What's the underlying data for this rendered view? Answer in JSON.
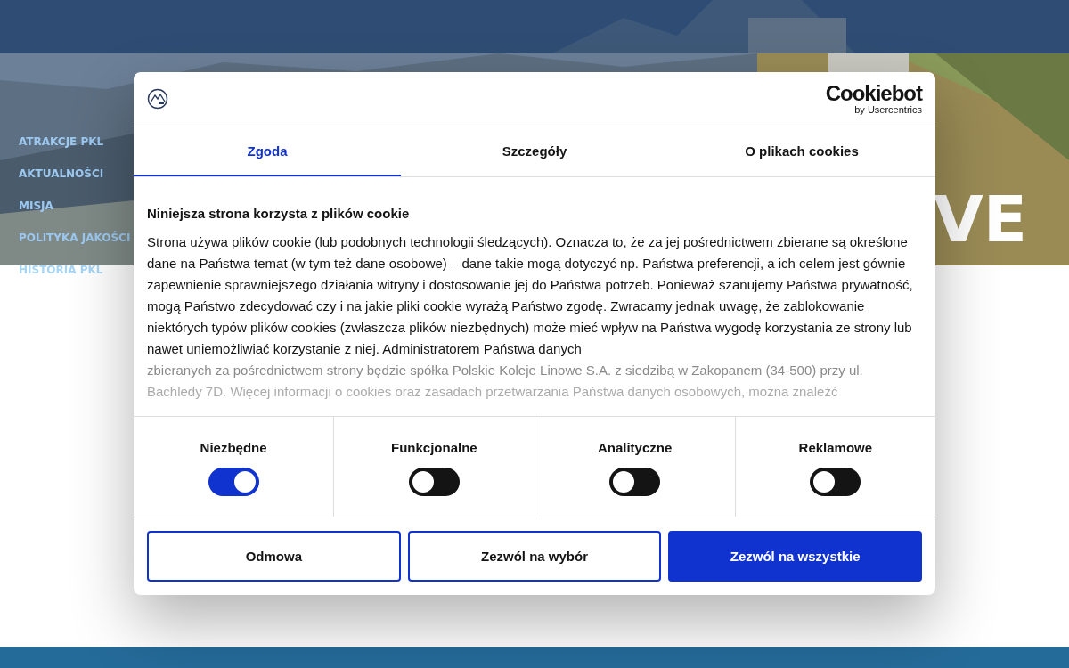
{
  "hero": {
    "heading": "VE"
  },
  "sidebar": {
    "items": [
      {
        "labels": [
          "ATRAKCJE PKL"
        ]
      },
      {
        "labels": [
          "AKTUALNOŚCI"
        ]
      },
      {
        "labels": [
          "MISJA"
        ]
      },
      {
        "labels": [
          "POLITYKA JAKOŚCI"
        ]
      },
      {
        "labels": [
          "HISTORIA PKL"
        ]
      }
    ]
  },
  "dialog": {
    "brand": {
      "name": "Cookiebot",
      "byline": "by Usercentrics"
    },
    "tabs": [
      {
        "label": "Zgoda",
        "selected": true
      },
      {
        "label": "Szczegóły",
        "selected": false
      },
      {
        "label": "O plikach cookies",
        "selected": false
      }
    ],
    "heading": "Niniejsza strona korzysta z plików cookie",
    "body": "Strona używa plików cookie (lub podobnych technologii śledzących). Oznacza to, że za jej pośrednictwem zbierane są określone dane na Państwa temat (w tym też dane osobowe) – dane takie mogą dotyczyć np. Państwa preferencji, a ich celem jest gównie zapewnienie sprawniejszego działania witryny i dostosowanie jej do Państwa potrzeb. Ponieważ szanujemy Państwa prywatność, mogą Państwo zdecydować czy i na jakie pliki cookie wyrażą Państwo zgodę. Zwracamy jednak uwagę, że zablokowanie niektórych typów plików cookies (zwłaszcza plików niezbędnych) może mieć wpływ na Państwa wygodę korzystania ze strony lub nawet uniemożliwiać korzystanie z niej. Administratorem Państwa danych",
    "body_faded": [
      "zbieranych za pośrednictwem strony będzie spółka Polskie Koleje Linowe S.A. z siedzibą w Zakopanem (34-500) przy ul.",
      "Bachledy 7D. Więcej informacji o cookies oraz zasadach przetwarzania Państwa danych osobowych, można znaleźć"
    ],
    "categories": [
      {
        "label": "Niezbędne",
        "on": true
      },
      {
        "label": "Funkcjonalne",
        "on": false
      },
      {
        "label": "Analityczne",
        "on": false
      },
      {
        "label": "Reklamowe",
        "on": false
      }
    ],
    "buttons": [
      {
        "label": "Odmowa",
        "kind": "outline"
      },
      {
        "label": "Zezwól na wybór",
        "kind": "outline"
      },
      {
        "label": "Zezwól na wszystkie",
        "kind": "primary"
      }
    ]
  }
}
